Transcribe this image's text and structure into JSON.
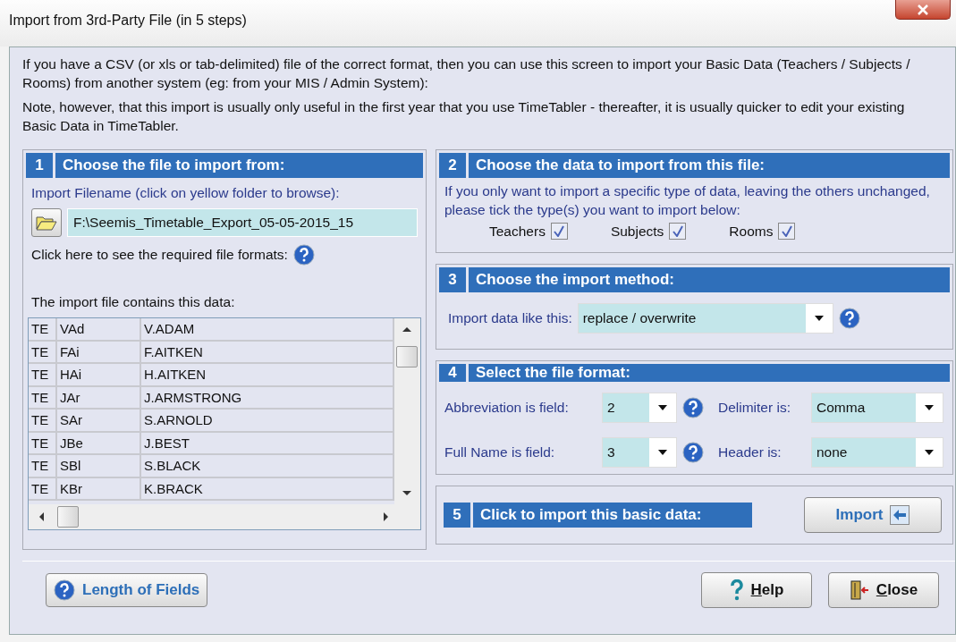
{
  "window": {
    "title": "Import from 3rd-Party File (in 5 steps)"
  },
  "intro": [
    "If you have a CSV (or xls or tab-delimited) file of the correct format, then you can use this screen to import your Basic Data (Teachers / Subjects / Rooms) from another system (eg: from your MIS / Admin System):",
    "Note, however, that this import is usually only useful in the first year that you use TimeTabler - thereafter, it is usually quicker to edit your existing Basic Data in TimeTabler."
  ],
  "step1": {
    "number": "1",
    "title": "Choose the file to import from:",
    "filename_label": "Import Filename (click on yellow folder to browse):",
    "filename": "F:\\Seemis_Timetable_Export_05-05-2015_15",
    "formats_label": "Click here to see the required file formats:",
    "data_label": "The import file contains this data:",
    "rows": [
      [
        "TE",
        "VAd",
        "V.ADAM"
      ],
      [
        "TE",
        "FAi",
        "F.AITKEN"
      ],
      [
        "TE",
        "HAi",
        "H.AITKEN"
      ],
      [
        "TE",
        "JAr",
        "J.ARMSTRONG"
      ],
      [
        "TE",
        "SAr",
        "S.ARNOLD"
      ],
      [
        "TE",
        "JBe",
        "J.BEST"
      ],
      [
        "TE",
        "SBl",
        "S.BLACK"
      ],
      [
        "TE",
        "KBr",
        "K.BRACK"
      ]
    ]
  },
  "step2": {
    "number": "2",
    "title": "Choose the data to import from this file:",
    "text": "If you only want to import a specific type of data, leaving the others unchanged, please tick the type(s) you want to import below:",
    "types": [
      {
        "label": "Teachers",
        "checked": true
      },
      {
        "label": "Subjects",
        "checked": true
      },
      {
        "label": "Rooms",
        "checked": true
      }
    ]
  },
  "step3": {
    "number": "3",
    "title": "Choose the import method:",
    "label": "Import data like this:",
    "value": "replace / overwrite"
  },
  "step4": {
    "number": "4",
    "title": "Select the file format:",
    "fields": [
      {
        "label": "Abbreviation is field:",
        "value": "2"
      },
      {
        "label": "Delimiter is:",
        "value": "Comma"
      },
      {
        "label": "Full Name is field:",
        "value": "3"
      },
      {
        "label": "Header is:",
        "value": "none"
      }
    ]
  },
  "step5": {
    "number": "5",
    "title": "Click to import this basic data:",
    "button": "Import"
  },
  "footer": {
    "length_button": "Length of Fields",
    "help_button": "Help",
    "close_button": "Close"
  }
}
